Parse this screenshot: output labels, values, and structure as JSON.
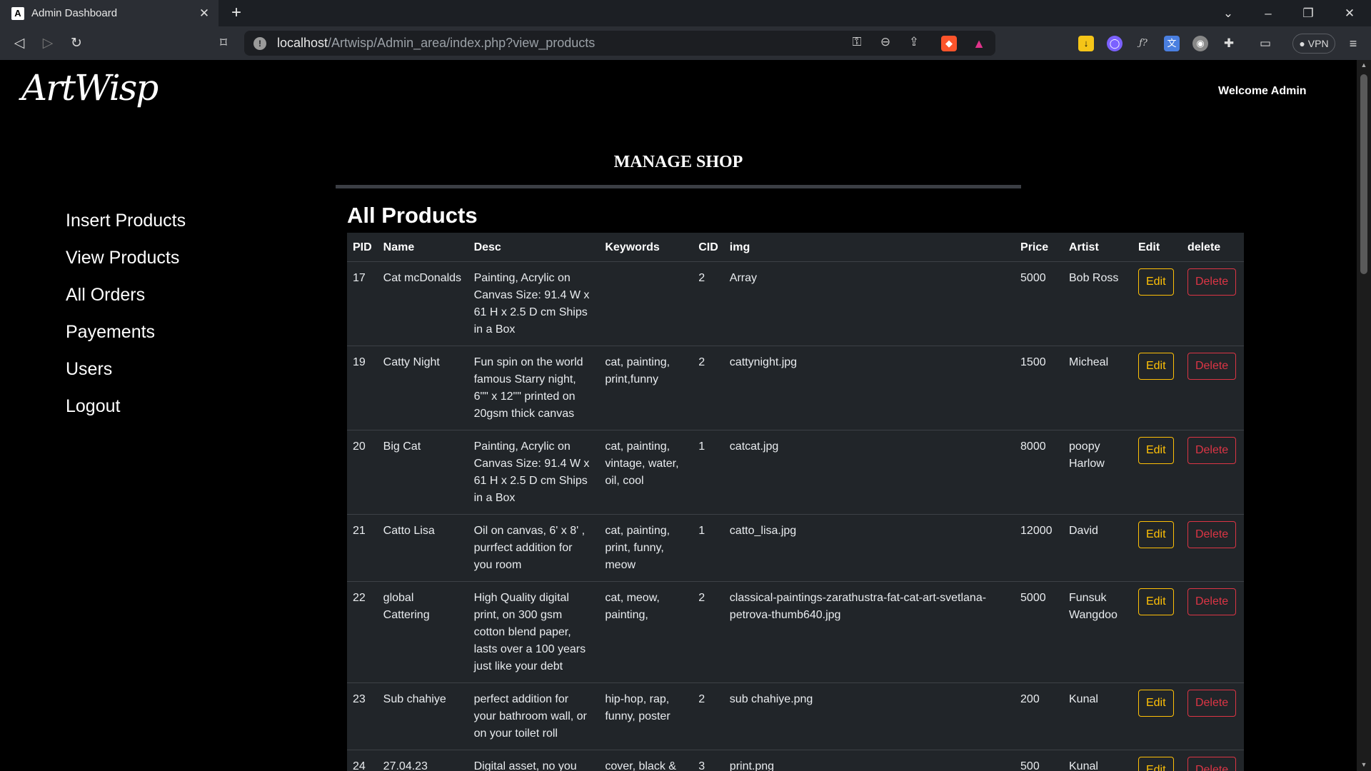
{
  "browser": {
    "tab_title": "Admin Dashboard",
    "url_host": "localhost",
    "url_path": "/Artwisp/Admin_area/index.php?view_products",
    "vpn_label": "● VPN"
  },
  "header": {
    "logo_text": "ArtWisp",
    "welcome": "Welcome Admin"
  },
  "manage_title": "MANAGE SHOP",
  "sidebar": {
    "items": [
      {
        "label": "Insert Products"
      },
      {
        "label": "View Products"
      },
      {
        "label": "All Orders"
      },
      {
        "label": "Payements"
      },
      {
        "label": "Users"
      },
      {
        "label": "Logout"
      }
    ]
  },
  "section_title": "All Products",
  "table": {
    "headers": [
      "PID",
      "Name",
      "Desc",
      "Keywords",
      "CID",
      "img",
      "Price",
      "Artist",
      "Edit",
      "delete"
    ],
    "edit_label": "Edit",
    "delete_label": "Delete",
    "rows": [
      {
        "pid": "17",
        "name": "Cat mcDonalds",
        "desc": "Painting, Acrylic on Canvas Size: 91.4 W x 61 H x 2.5 D cm Ships in a Box",
        "keywords": "",
        "cid": "2",
        "img": "Array",
        "price": "5000",
        "artist": "Bob Ross"
      },
      {
        "pid": "19",
        "name": "Catty Night",
        "desc": "Fun spin on the world famous Starry night, 6\"\" x 12\"\" printed on 20gsm thick canvas",
        "keywords": "cat, painting, print,funny",
        "cid": "2",
        "img": "cattynight.jpg",
        "price": "1500",
        "artist": "Micheal"
      },
      {
        "pid": "20",
        "name": "Big Cat",
        "desc": "Painting, Acrylic on Canvas Size: 91.4 W x 61 H x 2.5 D cm Ships in a Box",
        "keywords": "cat, painting, vintage, water, oil, cool",
        "cid": "1",
        "img": "catcat.jpg",
        "price": "8000",
        "artist": "poopy Harlow"
      },
      {
        "pid": "21",
        "name": "Catto Lisa",
        "desc": "Oil on canvas, 6' x 8' , purrfect addition for you room",
        "keywords": "cat, painting, print, funny, meow",
        "cid": "1",
        "img": "catto_lisa.jpg",
        "price": "12000",
        "artist": "David"
      },
      {
        "pid": "22",
        "name": "global Cattering",
        "desc": "High Quality digital print, on 300 gsm cotton blend paper, lasts over a 100 years just like your debt",
        "keywords": "cat, meow, painting,",
        "cid": "2",
        "img": "classical-paintings-zarathustra-fat-cat-art-svetlana-petrova-thumb640.jpg",
        "price": "5000",
        "artist": "Funsuk Wangdoo"
      },
      {
        "pid": "23",
        "name": "Sub chahiye",
        "desc": "perfect addition for your bathroom wall, or on your toilet roll",
        "keywords": "hip-hop, rap, funny, poster",
        "cid": "2",
        "img": "sub chahiye.png",
        "price": "200",
        "artist": "Kunal"
      },
      {
        "pid": "24",
        "name": "27.04.23",
        "desc": "Digital asset, no you cannot screenshot this,",
        "keywords": "cover, black & white,",
        "cid": "3",
        "img": "print.png",
        "price": "500",
        "artist": "Kunal"
      }
    ]
  },
  "colors": {
    "edit_button": "#ffc107",
    "delete_button": "#dc3545",
    "table_bg": "#212529"
  }
}
